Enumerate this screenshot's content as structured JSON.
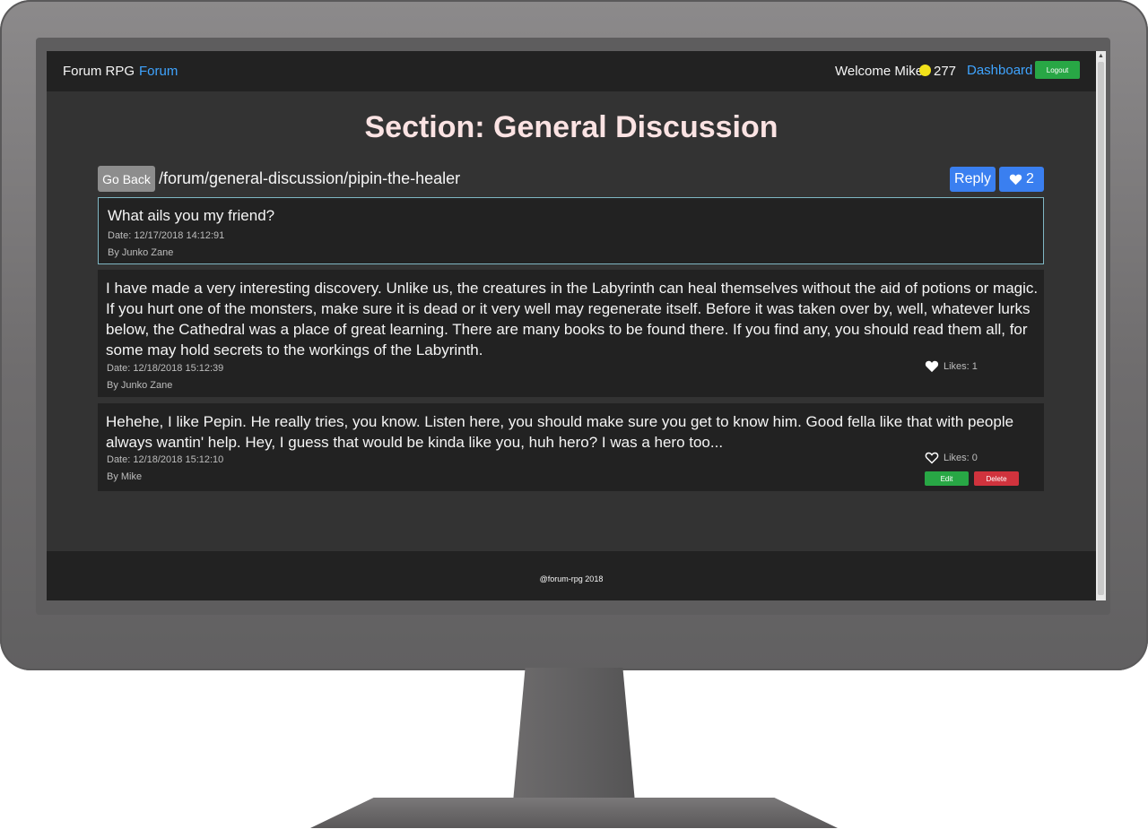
{
  "navbar": {
    "brand": "Forum RPG",
    "forum_link": "Forum",
    "welcome": "Welcome Mike",
    "coins": "277",
    "dashboard_link": "Dashboard",
    "logout_label": "Logout"
  },
  "page": {
    "section_title": "Section: General Discussion",
    "go_back_label": "Go Back",
    "path": "/forum/general-discussion/pipin-the-healer",
    "reply_label": "Reply",
    "topic_likes": "2"
  },
  "topic": {
    "title": "What ails you my friend?",
    "date": "Date: 12/17/2018 14:12:91",
    "author": "By Junko Zane"
  },
  "posts": [
    {
      "text": "I have made a very interesting discovery. Unlike us, the creatures in the Labyrinth can heal themselves without the aid of potions or magic. If you hurt one of the monsters, make sure it is dead or it very well may regenerate itself. Before it was taken over by, well, whatever lurks below, the Cathedral was a place of great learning. There are many books to be found there. If you find any, you should read them all, for some may hold secrets to the workings of the Labyrinth.",
      "date": "Date: 12/18/2018 15:12:39",
      "author": "By Junko Zane",
      "likes": "Likes: 1",
      "liked": true
    },
    {
      "text": "Hehehe, I like Pepin. He really tries, you know. Listen here, you should make sure you get to know him. Good fella like that with people always wantin' help. Hey, I guess that would be kinda like you, huh hero? I was a hero too...",
      "date": "Date: 12/18/2018 15:12:10",
      "author": "By Mike",
      "likes": "Likes: 0",
      "liked": false,
      "edit_label": "Edit",
      "delete_label": "Delete"
    }
  ],
  "footer": {
    "text": "@forum-rpg 2018"
  },
  "colors": {
    "link": "#3fa4ff",
    "primary": "#3a7ff0",
    "success": "#28a745",
    "danger": "#d0333d",
    "title": "#fbe3e3"
  },
  "icons": [
    "coin-icon",
    "heart-icon",
    "heart-outline-icon"
  ]
}
